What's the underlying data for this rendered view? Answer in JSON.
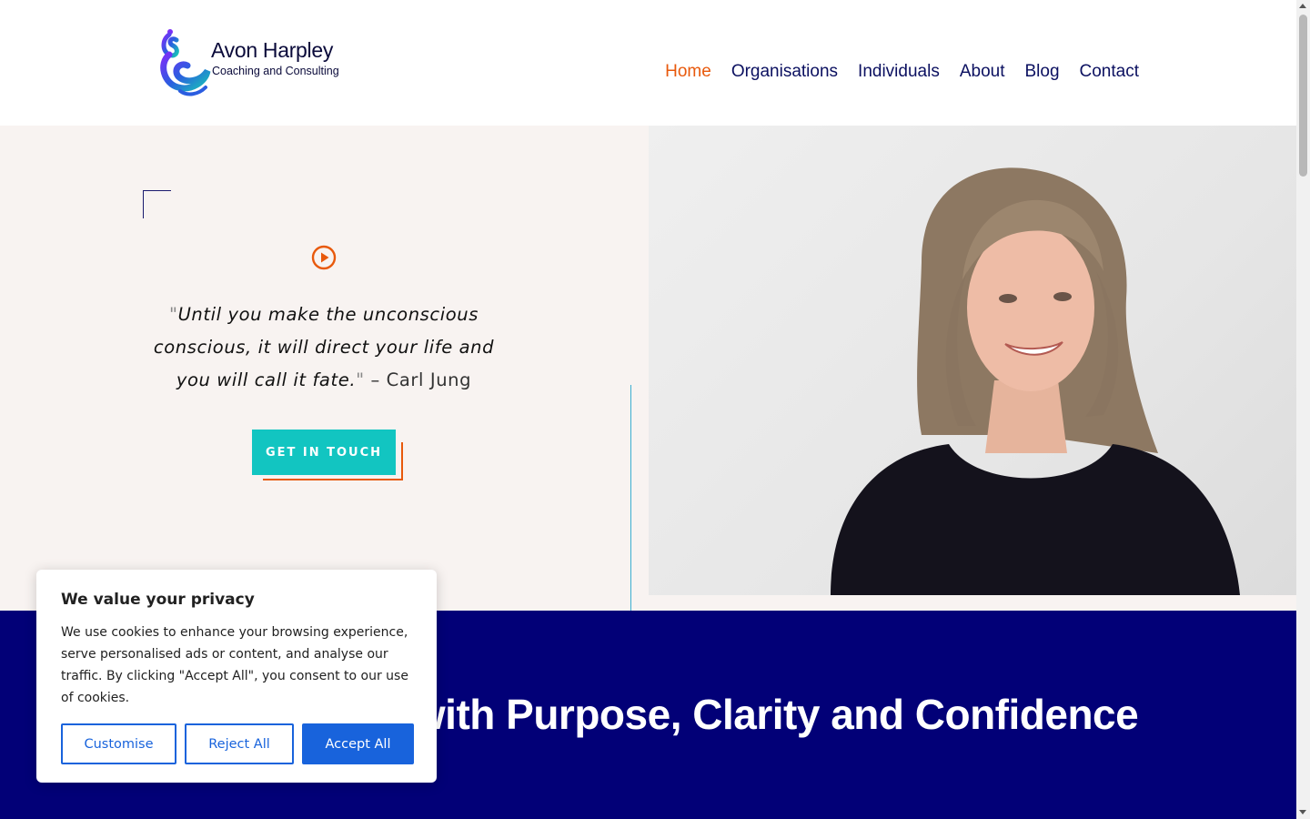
{
  "brand": {
    "name": "Avon Harpley",
    "tagline": "Coaching and Consulting",
    "logo_icon": "peacock-logo-icon"
  },
  "nav": {
    "items": [
      {
        "label": "Home",
        "active": true
      },
      {
        "label": "Organisations",
        "active": false
      },
      {
        "label": "Individuals",
        "active": false
      },
      {
        "label": "About",
        "active": false
      },
      {
        "label": "Blog",
        "active": false
      },
      {
        "label": "Contact",
        "active": false
      }
    ]
  },
  "hero": {
    "play_icon": "play-circle-icon",
    "quote_open": "\"",
    "quote_text": "Until you make the unconscious conscious, it will direct your life and you will call it fate.",
    "quote_close": "\"",
    "quote_author": " – Carl Jung",
    "cta_label": "GET IN TOUCH"
  },
  "band": {
    "title": "Creative Life with Purpose, Clarity and Confidence"
  },
  "cookie": {
    "title": "We value your privacy",
    "text": "We use cookies to enhance your browsing experience, serve personalised ads or content, and analyse our traffic. By clicking \"Accept All\", you consent to our use of cookies.",
    "customise_label": "Customise",
    "reject_label": "Reject All",
    "accept_label": "Accept All"
  },
  "colors": {
    "accent_orange": "#e8590c",
    "nav_blue": "#0b1060",
    "teal": "#12c5c1",
    "band_blue": "#020077",
    "cookie_blue": "#1863dc",
    "hero_bg": "#f8f3f1"
  }
}
